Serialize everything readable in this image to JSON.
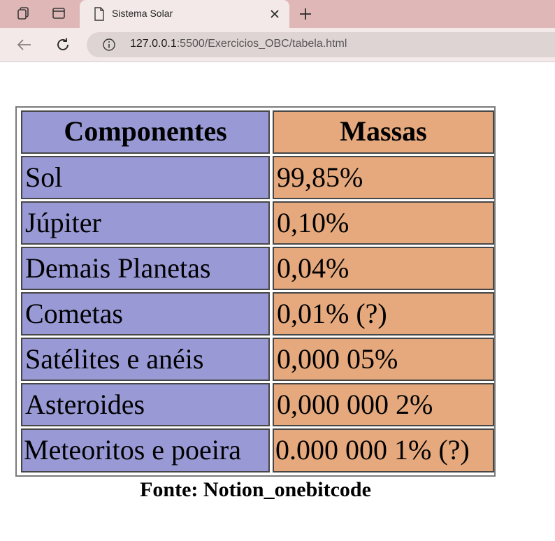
{
  "browser": {
    "tab_title": "Sistema Solar",
    "url_host": "127.0.0.1",
    "url_rest": ":5500/Exercicios_OBC/tabela.html"
  },
  "table": {
    "headers": [
      "Componentes",
      "Massas"
    ],
    "rows": [
      [
        "Sol",
        "99,85%"
      ],
      [
        "Júpiter",
        "0,10%"
      ],
      [
        "Demais Planetas",
        "0,04%"
      ],
      [
        "Cometas",
        "0,01% (?)"
      ],
      [
        "Satélites e anéis",
        "0,000 05%"
      ],
      [
        "Asteroides",
        "0,000 000 2%"
      ],
      [
        "Meteoritos e poeira",
        "0.000 000 1% (?)"
      ]
    ],
    "caption": "Fonte: Notion_onebitcode"
  },
  "colors": {
    "component_col": "#9999d6",
    "mass_col": "#e5a97d"
  }
}
